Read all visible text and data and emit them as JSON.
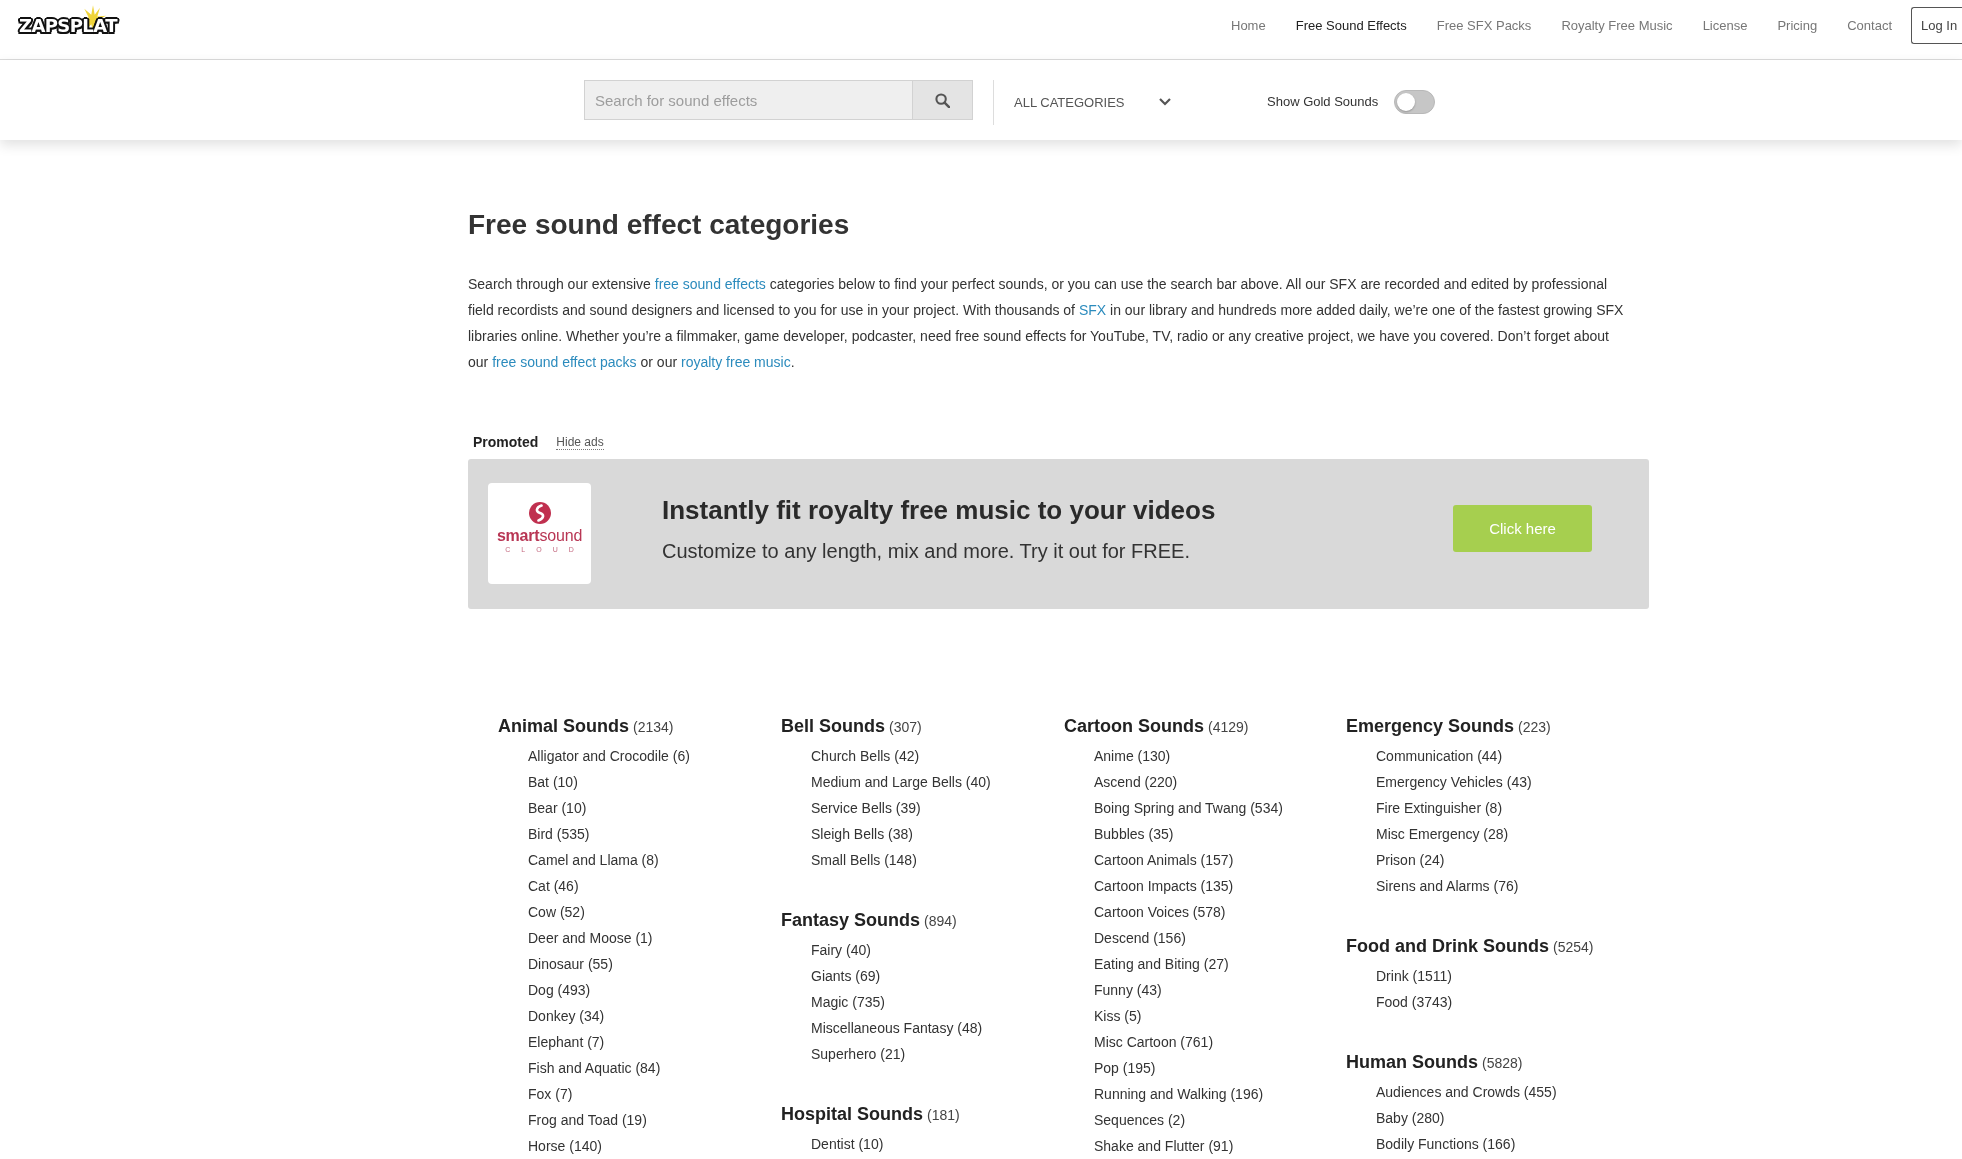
{
  "header": {
    "logo": "ZAPSPLAT",
    "nav": [
      {
        "label": "Home",
        "selected": false
      },
      {
        "label": "Free Sound Effects",
        "selected": true
      },
      {
        "label": "Free SFX Packs",
        "selected": false
      },
      {
        "label": "Royalty Free Music",
        "selected": false
      },
      {
        "label": "License",
        "selected": false
      },
      {
        "label": "Pricing",
        "selected": false
      },
      {
        "label": "Contact",
        "selected": false
      }
    ],
    "login": "Log In"
  },
  "search_bar": {
    "search": {
      "placeholder": "Search for sound effects"
    },
    "category_select": "ALL CATEGORIES",
    "gold_toggle": {
      "label": "Show Gold Sounds",
      "on": false
    }
  },
  "intro": {
    "title": "Free sound effect categories",
    "paragraph": [
      {
        "kind": "text",
        "text": "Search through our extensive "
      },
      {
        "kind": "link",
        "text": "free sound effects"
      },
      {
        "kind": "text",
        "text": " categories below to find your perfect sounds, or you can use the search bar above. All our SFX are recorded and edited by professional field recordists and sound designers and licensed to you for use in your project. With thousands of "
      },
      {
        "kind": "link",
        "text": "SFX"
      },
      {
        "kind": "text",
        "text": " in our library and hundreds more added daily, we’re one of the fastest growing SFX libraries online. Whether you’re a filmmaker, game developer, podcaster, need free sound effects for YouTube, TV, radio or any creative project, we have you covered. Don’t forget about our "
      },
      {
        "kind": "link",
        "text": "free sound effect packs"
      },
      {
        "kind": "text",
        "text": " or our "
      },
      {
        "kind": "link",
        "text": "royalty free music"
      },
      {
        "kind": "text",
        "text": "."
      }
    ]
  },
  "promoted": {
    "label": "Promoted",
    "hide_ads": "Hide ads",
    "ad": {
      "logo_text": "**smart**sound",
      "logo_subtext": "CLOUD",
      "headline": "Instantly fit royalty free music to your videos",
      "subtitle": "Customize to any length, mix and more. Try it out for FREE.",
      "button": "Click here"
    }
  },
  "categories": [
    {
      "groups": [
        {
          "name": "Animal Sounds",
          "count": "(2134)",
          "items": [
            "Alligator and Crocodile (6)",
            "Bat (10)",
            "Bear (10)",
            "Bird (535)",
            "Camel and Llama (8)",
            "Cat (46)",
            "Cow (52)",
            "Deer and Moose (1)",
            "Dinosaur (55)",
            "Dog (493)",
            "Donkey (34)",
            "Elephant (7)",
            "Fish and Aquatic (84)",
            "Fox (7)",
            "Frog and Toad (19)",
            "Horse (140)"
          ]
        }
      ]
    },
    {
      "groups": [
        {
          "name": "Bell Sounds",
          "count": "(307)",
          "items": [
            "Church Bells (42)",
            "Medium and Large Bells (40)",
            "Service Bells (39)",
            "Sleigh Bells (38)",
            "Small Bells (148)"
          ]
        },
        {
          "name": "Fantasy Sounds",
          "count": "(894)",
          "items": [
            "Fairy (40)",
            "Giants (69)",
            "Magic (735)",
            "Miscellaneous Fantasy (48)",
            "Superhero (21)"
          ]
        },
        {
          "name": "Hospital Sounds",
          "count": "(181)",
          "items": [
            "Dentist (10)"
          ]
        }
      ]
    },
    {
      "groups": [
        {
          "name": "Cartoon Sounds",
          "count": "(4129)",
          "items": [
            "Anime (130)",
            "Ascend (220)",
            "Boing Spring and Twang (534)",
            "Bubbles (35)",
            "Cartoon Animals (157)",
            "Cartoon Impacts (135)",
            "Cartoon Voices (578)",
            "Descend (156)",
            "Eating and Biting (27)",
            "Funny (43)",
            "Kiss (5)",
            "Misc Cartoon (761)",
            "Pop (195)",
            "Running and Walking (196)",
            "Sequences (2)",
            "Shake and Flutter (91)"
          ]
        }
      ]
    },
    {
      "groups": [
        {
          "name": "Emergency Sounds",
          "count": "(223)",
          "items": [
            "Communication (44)",
            "Emergency Vehicles (43)",
            "Fire Extinguisher (8)",
            "Misc Emergency (28)",
            "Prison (24)",
            "Sirens and Alarms (76)"
          ]
        },
        {
          "name": "Food and Drink Sounds",
          "count": "(5254)",
          "items": [
            "Drink (1511)",
            "Food (3743)"
          ]
        },
        {
          "name": "Human Sounds",
          "count": "(5828)",
          "items": [
            "Audiences and Crowds (455)",
            "Baby (280)",
            "Bodily Functions (166)"
          ]
        }
      ]
    }
  ]
}
